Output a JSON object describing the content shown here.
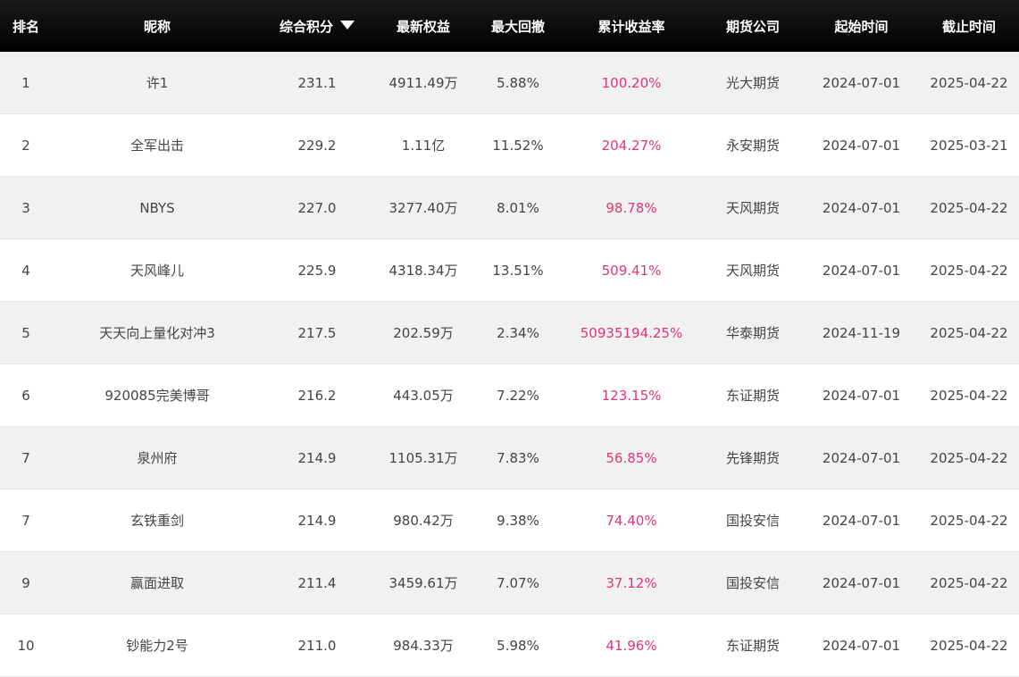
{
  "header": {
    "rank": "排名",
    "nickname": "昵称",
    "score": "综合积分",
    "equity": "最新权益",
    "drawdown": "最大回撤",
    "return": "累计收益率",
    "broker": "期货公司",
    "start": "起始时间",
    "end": "截止时间",
    "sort_icon": "triangle-down-icon"
  },
  "colors": {
    "header_bg": "#000000",
    "header_text": "#ffffff",
    "return_text": "#e0347c",
    "row_alt": "#f1f1f1"
  },
  "rows": [
    {
      "rank": "1",
      "nickname": "许1",
      "score": "231.1",
      "equity": "4911.49万",
      "drawdown": "5.88%",
      "return": "100.20%",
      "broker": "光大期货",
      "start": "2024-07-01",
      "end": "2025-04-22"
    },
    {
      "rank": "2",
      "nickname": "全军出击",
      "score": "229.2",
      "equity": "1.11亿",
      "drawdown": "11.52%",
      "return": "204.27%",
      "broker": "永安期货",
      "start": "2024-07-01",
      "end": "2025-03-21"
    },
    {
      "rank": "3",
      "nickname": "NBYS",
      "score": "227.0",
      "equity": "3277.40万",
      "drawdown": "8.01%",
      "return": "98.78%",
      "broker": "天风期货",
      "start": "2024-07-01",
      "end": "2025-04-22"
    },
    {
      "rank": "4",
      "nickname": "天风峰儿",
      "score": "225.9",
      "equity": "4318.34万",
      "drawdown": "13.51%",
      "return": "509.41%",
      "broker": "天风期货",
      "start": "2024-07-01",
      "end": "2025-04-22"
    },
    {
      "rank": "5",
      "nickname": "天天向上量化对冲3",
      "score": "217.5",
      "equity": "202.59万",
      "drawdown": "2.34%",
      "return": "50935194.25%",
      "broker": "华泰期货",
      "start": "2024-11-19",
      "end": "2025-04-22"
    },
    {
      "rank": "6",
      "nickname": "920085完美博哥",
      "score": "216.2",
      "equity": "443.05万",
      "drawdown": "7.22%",
      "return": "123.15%",
      "broker": "东证期货",
      "start": "2024-07-01",
      "end": "2025-04-22"
    },
    {
      "rank": "7",
      "nickname": "泉州府",
      "score": "214.9",
      "equity": "1105.31万",
      "drawdown": "7.83%",
      "return": "56.85%",
      "broker": "先锋期货",
      "start": "2024-07-01",
      "end": "2025-04-22"
    },
    {
      "rank": "7",
      "nickname": "玄铁重剑",
      "score": "214.9",
      "equity": "980.42万",
      "drawdown": "9.38%",
      "return": "74.40%",
      "broker": "国投安信",
      "start": "2024-07-01",
      "end": "2025-04-22"
    },
    {
      "rank": "9",
      "nickname": "赢面进取",
      "score": "211.4",
      "equity": "3459.61万",
      "drawdown": "7.07%",
      "return": "37.12%",
      "broker": "国投安信",
      "start": "2024-07-01",
      "end": "2025-04-22"
    },
    {
      "rank": "10",
      "nickname": "钞能力2号",
      "score": "211.0",
      "equity": "984.33万",
      "drawdown": "5.98%",
      "return": "41.96%",
      "broker": "东证期货",
      "start": "2024-07-01",
      "end": "2025-04-22"
    }
  ]
}
